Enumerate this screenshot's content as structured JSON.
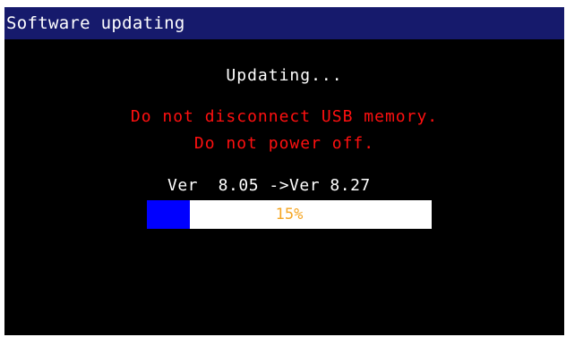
{
  "title_bar": {
    "title": "Software updating"
  },
  "status": {
    "text": "Updating..."
  },
  "warnings": [
    "Do not disconnect USB memory.",
    "Do not power off."
  ],
  "version": {
    "text": "Ver  8.05 ->Ver 8.27"
  },
  "progress": {
    "label": "15%",
    "fraction": 0.15
  },
  "colors": {
    "title_bar_bg": "#161a6c",
    "warning": "#ff1010",
    "progress_fill": "#0000ff",
    "progress_text": "#f5a623"
  }
}
